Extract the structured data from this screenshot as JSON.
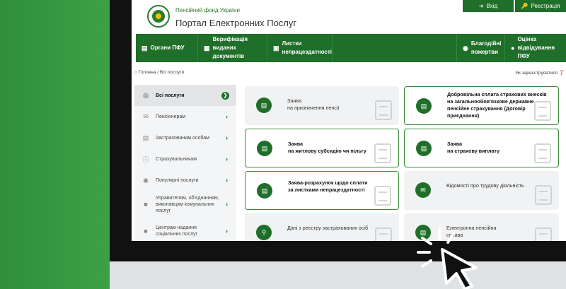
{
  "header": {
    "fund_name": "Пенсійний фонд України",
    "portal_name": "Портал Електронних Послуг",
    "login_label": "Вхід",
    "register_label": "Реєстрація"
  },
  "nav": {
    "items": [
      {
        "label": "Органи ПФУ",
        "icon": "map-icon"
      },
      {
        "label": "Верифікація виданих документів",
        "icon": "document-icon"
      },
      {
        "label": "Листки непрацездатності",
        "icon": "briefcase-icon"
      },
      {
        "label": "Благодійні пожертви",
        "icon": "donate-icon"
      },
      {
        "label": "Оцінка відвідування ПФУ",
        "icon": "chat-icon"
      }
    ]
  },
  "breadcrumb": {
    "home": "Головна",
    "current": "Всі послуги",
    "register_question": "Як зареєструватися"
  },
  "sidebar": {
    "items": [
      {
        "label": "Всі послуги",
        "active": true
      },
      {
        "label": "Пенсіонерам"
      },
      {
        "label": "Застрахованим особам"
      },
      {
        "label": "Страхувальникам"
      },
      {
        "label": "Популярні послуги"
      },
      {
        "label": "Управителям, об'єднанням, виконавцям комунальних послуг"
      },
      {
        "label": "Центрам надання соціальних послуг"
      }
    ]
  },
  "cards": [
    {
      "title": "Заява",
      "subtitle": "на призначення пенсії",
      "highlighted": false
    },
    {
      "title": "Добровільна сплата страхових внесків на загальнообов'язкове державне пенсійне страхування (Договір приєднання)",
      "highlighted": true
    },
    {
      "title": "Заява",
      "subtitle": "на житлову субсидію чи пільгу",
      "highlighted": true
    },
    {
      "title": "Заява",
      "subtitle": "на страхову виплату",
      "highlighted": true
    },
    {
      "title": "Заява-розрахунок щодо сплати за листками непрацездатності",
      "highlighted": true
    },
    {
      "title": "Відомості про трудову діяльність",
      "highlighted": false
    },
    {
      "title": "Дані з реєстру застрахованих осіб",
      "highlighted": false
    },
    {
      "title": "Електронна пенсійна справа",
      "highlighted": false
    }
  ],
  "colors": {
    "brand_green": "#1f6e2a",
    "page_green": "#3ea047",
    "frame": "#111111"
  }
}
